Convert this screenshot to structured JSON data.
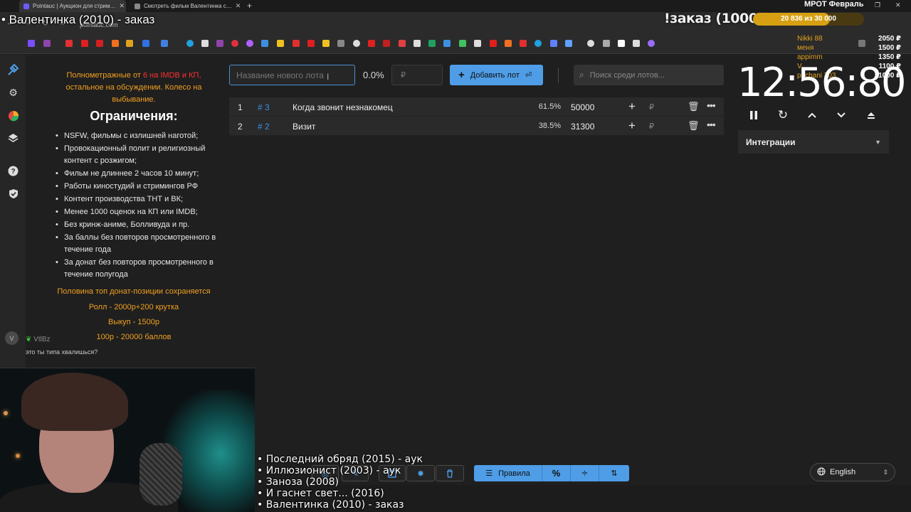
{
  "browser": {
    "tabs": [
      {
        "title": "Pointauc | Аукцион для стрим…",
        "close": "✕"
      },
      {
        "title": "Смотреть фильм Валентинка с…",
        "close": "✕"
      }
    ],
    "new_tab": "+",
    "url": "pointauc.com"
  },
  "stream_overlay": {
    "title": "• Валентинка (2010) - заказ",
    "order_title": "!заказ (1000р)",
    "goal_label": "МРОТ Февраль",
    "goal_progress_text": "20 836 из 30 000",
    "goal_current": 20836,
    "goal_target": 30000,
    "goal_fraction": 0.6945,
    "donors": [
      {
        "name": "Nikki 88",
        "amount": "2050 ₽"
      },
      {
        "name": "меня",
        "amount": "1500 ₽"
      },
      {
        "name": "appimm",
        "amount": "1350 ₽"
      },
      {
        "name": "V",
        "amount": "1100 ₽"
      },
      {
        "name": "pachani 703",
        "amount": "1000 ₽"
      }
    ],
    "timer": "12:56:80",
    "history": [
      "• Последний обряд (2015) - аук",
      "• Иллюзионист (2003) - аук",
      "• Заноза (2008)",
      "• И гаснет свет... (2016)",
      "• Валентинка (2010) - заказ"
    ]
  },
  "sidebar": {
    "icons": [
      "auction-icon",
      "settings-icon",
      "pie-chart-icon",
      "layers-icon",
      "help-icon",
      "shield-icon"
    ]
  },
  "rules_panel": {
    "intro_part1": "Полнометражные от",
    "intro_red": "6 на IMDB и КП,",
    "intro_part2": "остальное на обсуждении. Колесо на выбывание.",
    "heading": "Ограничения:",
    "items": [
      "NSFW, фильмы с излишней наготой;",
      "Провокационный полит и религиозный контент с розжигом;",
      "Фильм не длиннее 2 часов 10 минут;",
      "Работы киностудий и стримингов РФ",
      "Контент производства ТНТ и ВК;",
      "Менее 1000 оценок на КП или IMDB;",
      "Без кринж-аниме, Болливуда и пр.",
      "За баллы без повторов просмотренного в течение года",
      "За донат без повторов просмотренного в течение полугода"
    ],
    "extras": [
      "Половина топ донат-позиции сохраняется",
      "Ролл - 2000р+200 крутка",
      "Выкуп - 1500р",
      "100р - 20000 баллов"
    ]
  },
  "chat": {
    "avatar_letter": "V",
    "user": "VtlBz",
    "message": "это ты типа хвалишься?"
  },
  "controls": {
    "lot_name_placeholder": "Название нового лота",
    "percent": "0.0%",
    "amount_placeholder": "₽",
    "add_button_label": "Добавить лот",
    "add_button_enter": "⏎",
    "search_placeholder": "Поиск среди лотов..."
  },
  "lots": [
    {
      "index": "1",
      "hash": "# 3",
      "name": "Когда звонит незнакомец",
      "percent": "61.5%",
      "amount": "50000",
      "currency": "₽"
    },
    {
      "index": "2",
      "hash": "# 2",
      "name": "Визит",
      "percent": "38.5%",
      "amount": "31300",
      "currency": "₽"
    }
  ],
  "timer_controls": {
    "integrations_label": "Интеграции"
  },
  "bottom_toolbar": {
    "rules_label": "Правила",
    "language": "English"
  },
  "colors": {
    "accent_blue": "#4e9de6",
    "warning_orange": "#f0a020",
    "danger_red": "#ff3030"
  }
}
